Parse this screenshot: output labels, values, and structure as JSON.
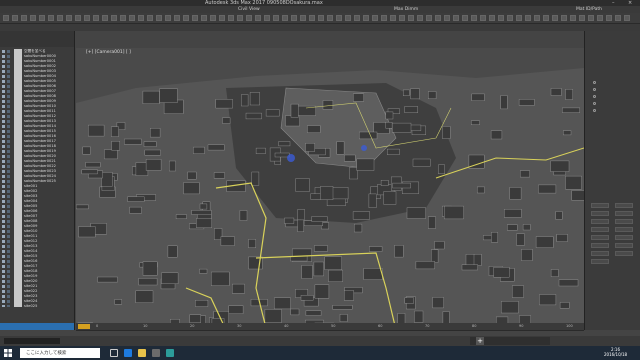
{
  "window": {
    "title": "Autodesk 3ds Max 2017    090508DOsakura.max"
  },
  "menubar": {
    "items": [
      "",
      "",
      "",
      "",
      "",
      "",
      "",
      "",
      "",
      "Civil View",
      "",
      "",
      "",
      "",
      "",
      "Max Dimm",
      "",
      "",
      "",
      "",
      "",
      "",
      "Mat ID/Path"
    ]
  },
  "toolbar": {
    "labels": [
      "",
      "",
      ""
    ]
  },
  "viewport": {
    "label": "[+] [Camera001] [ ]"
  },
  "scene_explorer": {
    "items": [
      "空間を並べる",
      "sakuNumber0000",
      "sakuNumber0001",
      "sakuNumber0002",
      "sakuNumber0003",
      "sakuNumber0004",
      "sakuNumber0005",
      "sakuNumber0006",
      "sakuNumber0007",
      "sakuNumber0008",
      "sakuNumber0009",
      "sakuNumber0010",
      "sakuNumber0011",
      "sakuNumber0012",
      "sakuNumber0013",
      "sakuNumber0014",
      "sakuNumber0015",
      "sakuNumber0016",
      "sakuNumber0017",
      "sakuNumber0018",
      "sakuNumber0019",
      "sakuNumber0020",
      "sakuNumber0021",
      "sakuNumber0022",
      "sakuNumber0023",
      "sakuNumber0024",
      "sakuNumber0025",
      "site001",
      "site002",
      "site003",
      "site004",
      "site005",
      "site006",
      "site007",
      "site008",
      "site009",
      "site010",
      "site011",
      "site012",
      "site013",
      "site014",
      "site015",
      "site016",
      "site017",
      "site018",
      "site019",
      "site020",
      "site021",
      "site022",
      "site023",
      "site024",
      "site025"
    ],
    "footer": ""
  },
  "command_panel": {
    "radios": [
      "",
      "",
      "",
      "",
      ""
    ],
    "buttons": [
      "",
      "",
      "",
      "",
      "",
      "",
      "",
      "",
      "",
      "",
      "",
      "",
      "",
      "",
      ""
    ]
  },
  "timeline": {
    "ticks": [
      0,
      10,
      20,
      30,
      40,
      50,
      60,
      70,
      80,
      90,
      100
    ]
  },
  "taskbar": {
    "search_placeholder": "ここに入力して検索",
    "time": "2:16",
    "date": "2016/10/18"
  },
  "colors": {
    "accent": "#2b6fb0",
    "bg": "#444444",
    "highlight": "#d9d25a"
  }
}
